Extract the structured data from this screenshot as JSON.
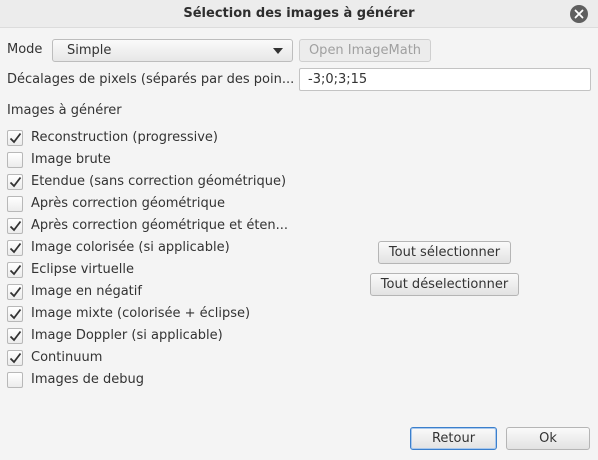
{
  "window": {
    "title": "Sélection des images à générer"
  },
  "mode": {
    "label": "Mode",
    "selected": "Simple",
    "imagemath_button": "Open ImageMath"
  },
  "offsets": {
    "label": "Décalages de pixels (séparés par des poin...",
    "value": "-3;0;3;15"
  },
  "images": {
    "heading": "Images à générer",
    "items": [
      {
        "label": "Reconstruction (progressive)",
        "checked": true
      },
      {
        "label": "Image brute",
        "checked": false
      },
      {
        "label": "Etendue (sans correction géométrique)",
        "checked": true
      },
      {
        "label": "Après correction géométrique",
        "checked": false
      },
      {
        "label": "Après correction géométrique et éten...",
        "checked": true
      },
      {
        "label": "Image colorisée (si applicable)",
        "checked": true
      },
      {
        "label": "Eclipse virtuelle",
        "checked": true
      },
      {
        "label": "Image en négatif",
        "checked": true
      },
      {
        "label": "Image mixte (colorisée + éclipse)",
        "checked": true
      },
      {
        "label": "Image Doppler (si applicable)",
        "checked": true
      },
      {
        "label": "Continuum",
        "checked": true
      },
      {
        "label": "Images de debug",
        "checked": false
      }
    ]
  },
  "actions": {
    "select_all": "Tout sélectionner",
    "deselect_all": "Tout déselectionner",
    "back": "Retour",
    "ok": "Ok"
  }
}
